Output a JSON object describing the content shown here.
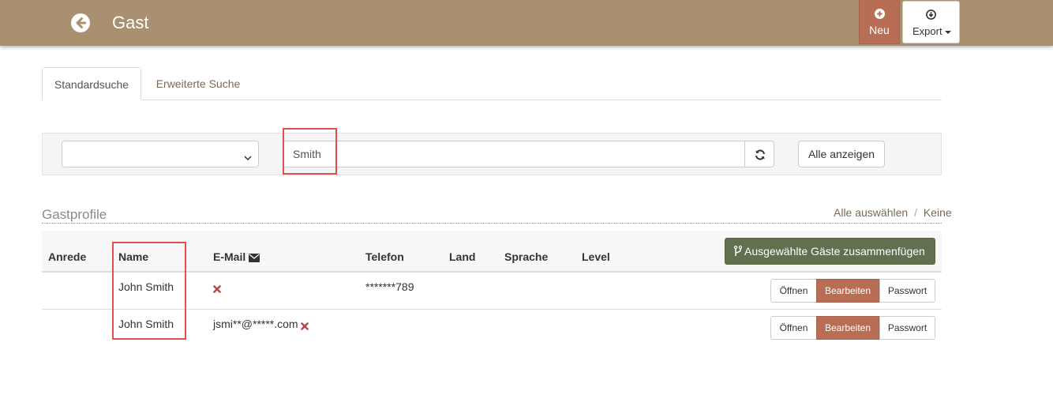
{
  "header": {
    "title": "Gast",
    "back_icon": "circle-arrow-left-icon",
    "new_label": "Neu",
    "new_icon": "plus-circle-icon",
    "export_label": "Export",
    "export_icon": "download-circle-icon",
    "bar_color": "#a89070",
    "accent_color": "#b76e54"
  },
  "tabs": [
    {
      "label": "Standardsuche",
      "active": true
    },
    {
      "label": "Erweiterte Suche",
      "active": false
    }
  ],
  "search": {
    "select_value": "",
    "query": "Smith",
    "refresh_icon": "refresh-icon",
    "show_all_label": "Alle anzeigen"
  },
  "section": {
    "title": "Gastprofile",
    "select_all": "Alle auswählen",
    "separator": "/",
    "select_none": "Keine"
  },
  "table": {
    "columns": [
      "Anrede",
      "Name",
      "E-Mail",
      "Telefon",
      "Land",
      "Sprache",
      "Level"
    ],
    "email_icon": "envelope-icon",
    "merge_label": "Ausgewählte Gäste zusammenfügen",
    "merge_icon": "code-fork-icon",
    "row_actions": {
      "open": "Öffnen",
      "edit": "Bearbeiten",
      "password": "Passwort"
    },
    "rows": [
      {
        "anrede": "",
        "name": "John Smith",
        "email": "",
        "email_invalid": true,
        "telefon": "*******789",
        "land": "",
        "sprache": "",
        "level": ""
      },
      {
        "anrede": "",
        "name": "John Smith",
        "email": "jsmi**@*****.com",
        "email_invalid": true,
        "telefon": "",
        "land": "",
        "sprache": "",
        "level": ""
      }
    ]
  }
}
